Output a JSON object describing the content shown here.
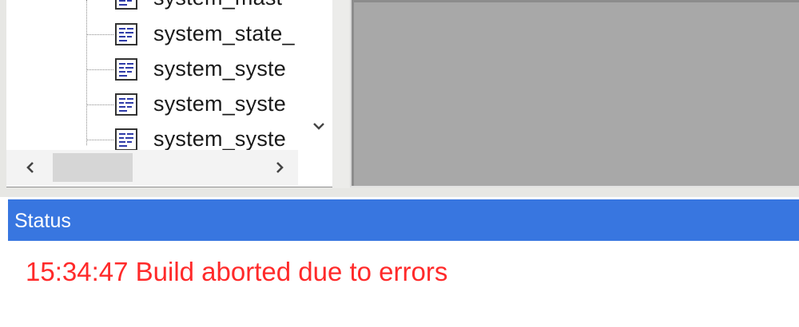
{
  "tree": {
    "items": [
      {
        "label": "system_mast",
        "icon": "table-icon"
      },
      {
        "label": "system_state_",
        "icon": "table-icon"
      },
      {
        "label": "system_syste",
        "icon": "table-icon"
      },
      {
        "label": "system_syste",
        "icon": "table-icon"
      },
      {
        "label": "system_syste",
        "icon": "table-icon"
      }
    ]
  },
  "status": {
    "title": "Status",
    "message": "15:34:47 Build aborted due to errors",
    "message_color": "#ff2a2a",
    "header_color": "#3876e0"
  }
}
